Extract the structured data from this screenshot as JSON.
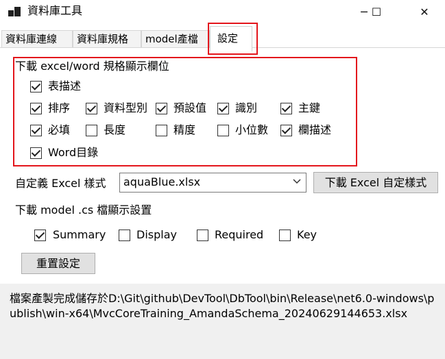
{
  "window": {
    "title": "資料庫工具",
    "minimize": "─",
    "maximize": "☐",
    "close": "✕"
  },
  "tabs": [
    {
      "label": "資料庫連線"
    },
    {
      "label": "資料庫規格"
    },
    {
      "label": "model產檔"
    },
    {
      "label": "設定",
      "active": true
    }
  ],
  "excel_section": {
    "heading": "下載 excel/word 規格顯示欄位",
    "options": [
      {
        "label": "表描述",
        "checked": true
      },
      {
        "label": "排序",
        "checked": true
      },
      {
        "label": "資料型別",
        "checked": true
      },
      {
        "label": "預設值",
        "checked": true
      },
      {
        "label": "識別",
        "checked": true
      },
      {
        "label": "主鍵",
        "checked": true
      },
      {
        "label": "必填",
        "checked": true
      },
      {
        "label": "長度",
        "checked": false
      },
      {
        "label": "精度",
        "checked": false
      },
      {
        "label": "小位數",
        "checked": false
      },
      {
        "label": "欄描述",
        "checked": true
      },
      {
        "label": "Word目錄",
        "checked": true
      }
    ]
  },
  "excel_style": {
    "label": "自定義 Excel 樣式",
    "selected": "aquaBlue.xlsx",
    "download_button": "下載 Excel 自定樣式"
  },
  "model_section": {
    "heading": "下載 model .cs 檔顯示設置",
    "options": [
      {
        "label": "Summary",
        "checked": true
      },
      {
        "label": "Display",
        "checked": false
      },
      {
        "label": "Required",
        "checked": false
      },
      {
        "label": "Key",
        "checked": false
      }
    ]
  },
  "reset_button": "重置設定",
  "status": "檔案產製完成儲存於D:\\Git\\github\\DevTool\\DbTool\\bin\\Release\\net6.0-windows\\publish\\win-x64\\MvcCoreTraining_AmandaSchema_20240629144653.xlsx",
  "colors": {
    "highlight": "#e3141b",
    "status_bg": "#f0f0f0",
    "button_bg": "#e1e1e1"
  }
}
